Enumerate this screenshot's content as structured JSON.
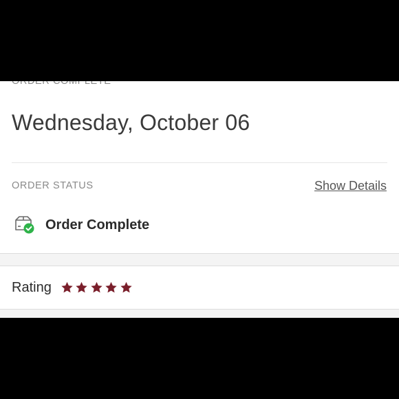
{
  "order": {
    "section_label": "ORDER COMPLETE",
    "date": "Wednesday, October 06"
  },
  "status": {
    "label": "ORDER STATUS",
    "show_details": "Show Details",
    "text": "Order Complete",
    "icon": "package-check-icon"
  },
  "rating": {
    "label": "Rating",
    "stars": 5,
    "max_stars": 5,
    "star_color": "#7a1f2b"
  },
  "colors": {
    "check_green": "#2fb34a"
  }
}
